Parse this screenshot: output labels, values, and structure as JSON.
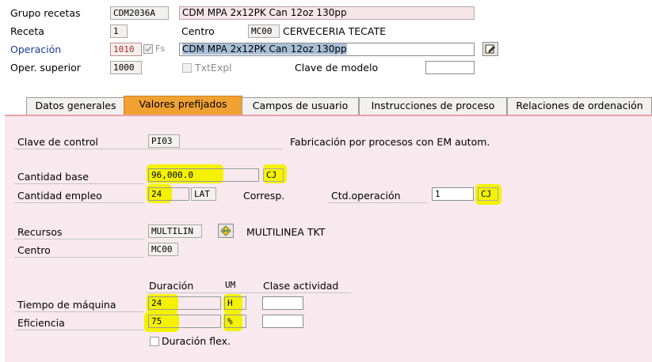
{
  "header": {
    "grupo_recetas_label": "Grupo recetas",
    "grupo_recetas_value": "CDM2036A",
    "grupo_recetas_desc": "CDM MPA 2x12PK Can 12oz 130pp",
    "receta_label": "Receta",
    "receta_value": "1",
    "centro_label": "Centro",
    "centro_value": "MC00",
    "centro_desc": "CERVECERIA TECATE",
    "operacion_label": "Operación",
    "operacion_value": "1010",
    "fs_label": "Fs",
    "operacion_desc": "CDM MPA 2x12PK Can 12oz 130pp",
    "oper_superior_label": "Oper. superior",
    "oper_superior_value": "1000",
    "txtexpl_label": "TxtExpl",
    "clave_modelo_label": "Clave de modelo",
    "clave_modelo_value": ""
  },
  "tabs": [
    {
      "label": "Datos generales"
    },
    {
      "label": "Valores prefijados"
    },
    {
      "label": "Campos de usuario"
    },
    {
      "label": "Instrucciones de proceso"
    },
    {
      "label": "Relaciones de ordenación"
    }
  ],
  "panel": {
    "clave_control_label": "Clave de control",
    "clave_control_value": "PI03",
    "clave_control_desc": "Fabricación por procesos con EM autom.",
    "cantidad_base_label": "Cantidad base",
    "cantidad_base_value": "96,000.0",
    "cantidad_base_unit": "CJ",
    "cantidad_empleo_label": "Cantidad empleo",
    "cantidad_empleo_value": "24",
    "cantidad_empleo_unit": "LAT",
    "corresp_label": "Corresp.",
    "ctd_operacion_label": "Ctd.operación",
    "ctd_operacion_value": "1",
    "ctd_operacion_unit": "CJ",
    "recursos_label": "Recursos",
    "recursos_value": "MULTILIN",
    "recursos_desc": "MULTILINEA TKT",
    "centro_label": "Centro",
    "centro_value": "MC00",
    "duracion_header": "Duración",
    "um_header": "UM",
    "clase_actividad_header": "Clase actividad",
    "tiempo_maquina_label": "Tiempo de máquina",
    "tiempo_maquina_value": "24",
    "tiempo_maquina_um": "H",
    "eficiencia_label": "Eficiencia",
    "eficiencia_value": "75",
    "eficiencia_um": "%",
    "duracion_flex_label": "Duración flex."
  },
  "colors": {
    "highlight": "#f4f200",
    "active_tab": "#f0a132",
    "panel_bg": "#f7e9ed",
    "label_blue": "#1a3a9c"
  }
}
